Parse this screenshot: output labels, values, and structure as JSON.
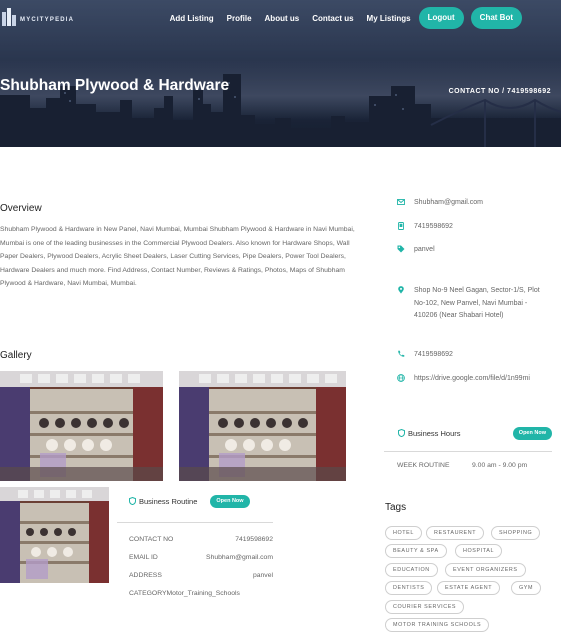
{
  "brand": {
    "name": "MYCITYPEDIA"
  },
  "nav": {
    "links": [
      "Add Listing",
      "Profile",
      "About us",
      "Contact us",
      "My Listings"
    ],
    "logout_label": "Logout",
    "chatbot_label": "Chat Bot"
  },
  "hero": {
    "title": "Shubham Plywood & Hardware",
    "contact": "CONTACT NO / 7419598692"
  },
  "overview": {
    "heading": "Overview",
    "text": "Shubham Plywood & Hardware in New Panel, Navi Mumbai, Mumbai Shubham Plywood & Hardware in Navi Mumbai, Mumbai is one of the leading businesses in the Commercial Plywood Dealers. Also known for Hardware Shops, Wall Paper Dealers, Plywood Dealers, Acrylic Sheet Dealers, Laser Cutting Services, Pipe Dealers, Power Tool Dealers, Hardware Dealers and much more. Find Address, Contact Number, Reviews & Ratings, Photos, Maps of Shubham Plywood & Hardware, Navi Mumbai, Mumbai."
  },
  "gallery": {
    "heading": "Gallery"
  },
  "routine": {
    "title": "Business Routine",
    "badge": "Open Now",
    "rows": [
      {
        "key": "CONTACT NO",
        "value": "7419598692"
      },
      {
        "key": "EMAIL ID",
        "value": "Shubham@gmail.com"
      },
      {
        "key": "ADDRESS",
        "value": "panvel"
      },
      {
        "key": "CATEGORY",
        "value": "Motor_Training_Schools"
      }
    ]
  },
  "info": {
    "email": "Shubham@gmail.com",
    "phone": "7419598692",
    "tag": "panvel",
    "address": "Shop No-9 Neel Gagan, Sector-1/S, Plot No-102, New Panvel, Navi Mumbai - 410206 (Near Shabari Hotel)",
    "phone2": "7419598692",
    "website": "https://drive.google.com/file/d/1n99mi"
  },
  "hours": {
    "title": "Business Hours",
    "badge": "Open Now",
    "row_key": "WEEK ROUTINE",
    "row_value": "9.00 am - 9.00 pm"
  },
  "tags": {
    "heading": "Tags",
    "items": [
      "HOTEL",
      "RESTAURENT",
      "SHOPPING",
      "BEAUTY & SPA",
      "HOSPITAL",
      "EDUCATION",
      "EVENT ORGANIZERS",
      "DENTISTS",
      "ESTATE AGENT",
      "GYM",
      "COURIER SERVICES",
      "MOTOR TRAINING SCHOOLS"
    ]
  },
  "colors": {
    "accent": "#21b5a8",
    "hero_dark": "#1f2a40",
    "text_muted": "#666666"
  },
  "icons": [
    "mail-icon",
    "phone-icon",
    "tag-icon",
    "pin-icon",
    "globe-icon",
    "shield-icon"
  ]
}
